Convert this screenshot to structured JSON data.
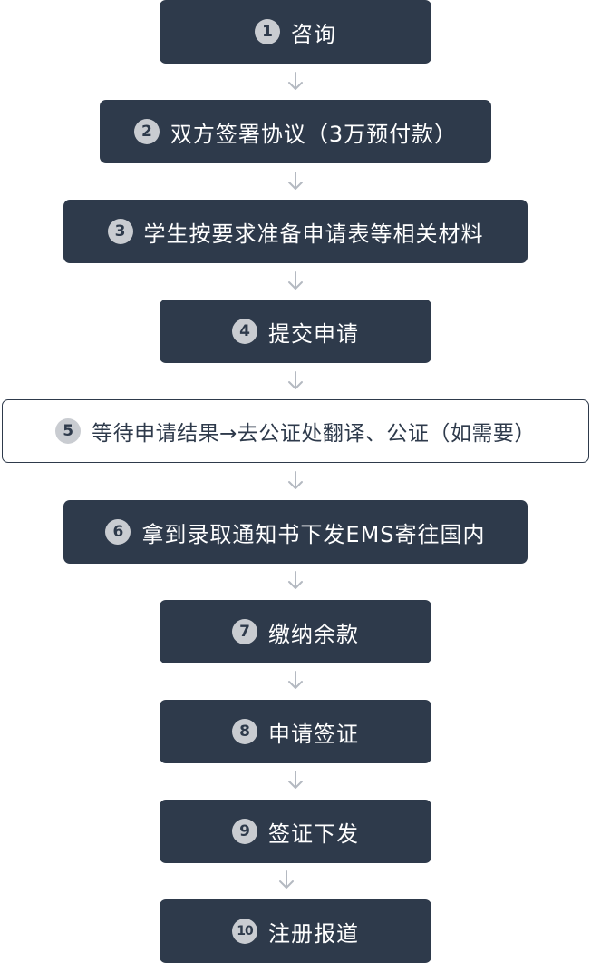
{
  "colors": {
    "box_dark": "#2e3a4b",
    "box_light_border": "#2e3a4b",
    "number_badge": "#c9ccd1",
    "arrow": "#b4b9c1"
  },
  "steps": [
    {
      "number": "1",
      "label": "咨询"
    },
    {
      "number": "2",
      "label": "双方签署协议（3万预付款）"
    },
    {
      "number": "3",
      "label": "学生按要求准备申请表等相关材料"
    },
    {
      "number": "4",
      "label": "提交申请"
    },
    {
      "number": "5",
      "label": "等待申请结果→去公证处翻译、公证（如需要）"
    },
    {
      "number": "6",
      "label": "拿到录取通知书下发EMS寄往国内"
    },
    {
      "number": "7",
      "label": "缴纳余款"
    },
    {
      "number": "8",
      "label": "申请签证"
    },
    {
      "number": "9",
      "label": "签证下发"
    },
    {
      "number": "10",
      "label": "注册报道"
    }
  ]
}
